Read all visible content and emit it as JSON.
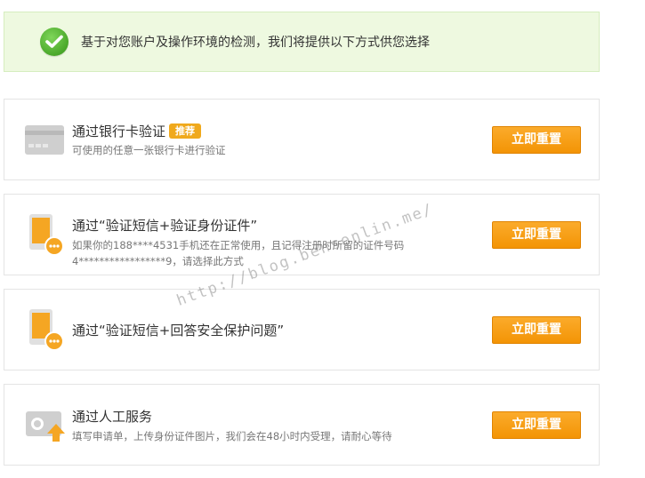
{
  "notice": {
    "text": "基于对您账户及操作环境的检测，我们将提供以下方式供您选择"
  },
  "options": [
    {
      "title": "通过银行卡验证",
      "badge": "推荐",
      "desc_line1": "可使用的任意一张银行卡进行验证",
      "desc_line2": "",
      "button": "立即重置",
      "icon": "bank-card-icon"
    },
    {
      "title": "通过“验证短信+验证身份证件”",
      "desc_line1": "如果你的188****4531手机还在正常使用，且记得注册时所留的证件号码",
      "desc_line2": "4*****************9，请选择此方式",
      "button": "立即重置",
      "icon": "phone-sms-icon"
    },
    {
      "title": "通过“验证短信+回答安全保护问题”",
      "desc_line1": "",
      "desc_line2": "",
      "button": "立即重置",
      "icon": "phone-sms-icon"
    },
    {
      "title": "通过人工服务",
      "desc_line1": "填写申请单，上传身份证件图片，我们会在48小时内受理，请耐心等待",
      "desc_line2": "",
      "button": "立即重置",
      "icon": "id-upload-icon"
    }
  ],
  "watermark": "http://blog.bensonlin.me/"
}
